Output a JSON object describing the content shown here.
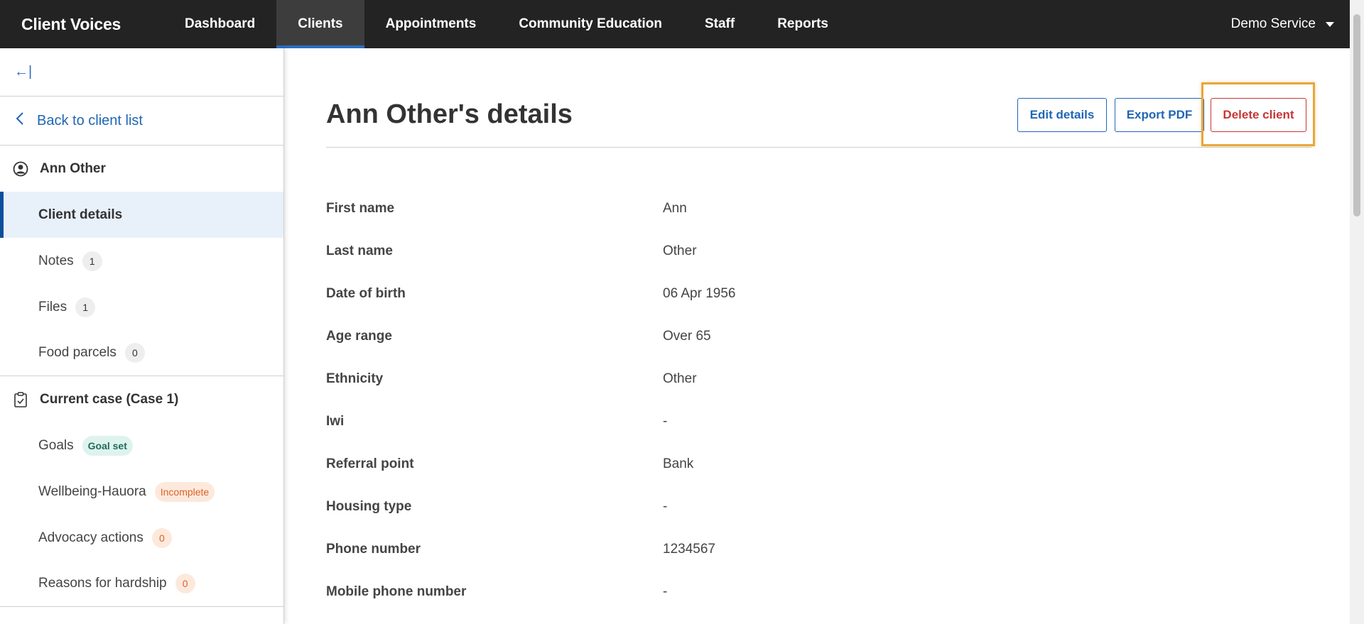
{
  "app": {
    "brand": "Client Voices"
  },
  "nav": {
    "items": [
      {
        "label": "Dashboard"
      },
      {
        "label": "Clients"
      },
      {
        "label": "Appointments"
      },
      {
        "label": "Community Education"
      },
      {
        "label": "Staff"
      },
      {
        "label": "Reports"
      }
    ],
    "service": "Demo Service"
  },
  "sidebar": {
    "collapse_glyph": "←|",
    "back_label": "Back to client list",
    "client_name": "Ann Other",
    "client_items": [
      {
        "label": "Client details"
      },
      {
        "label": "Notes",
        "badge": "1"
      },
      {
        "label": "Files",
        "badge": "1"
      },
      {
        "label": "Food parcels",
        "badge": "0"
      }
    ],
    "case_title": "Current case (Case 1)",
    "case_items": [
      {
        "label": "Goals",
        "badge": "Goal set"
      },
      {
        "label": "Wellbeing-Hauora",
        "badge": "Incomplete"
      },
      {
        "label": "Advocacy actions",
        "badge": "0"
      },
      {
        "label": "Reasons for hardship",
        "badge": "0"
      }
    ]
  },
  "main": {
    "title": "Ann Other's details",
    "buttons": {
      "edit": "Edit details",
      "export": "Export PDF",
      "delete": "Delete client"
    },
    "fields": [
      {
        "label": "First name",
        "value": "Ann"
      },
      {
        "label": "Last name",
        "value": "Other"
      },
      {
        "label": "Date of birth",
        "value": "06 Apr 1956"
      },
      {
        "label": "Age range",
        "value": "Over 65"
      },
      {
        "label": "Ethnicity",
        "value": "Other"
      },
      {
        "label": "Iwi",
        "value": "-"
      },
      {
        "label": "Referral point",
        "value": "Bank"
      },
      {
        "label": "Housing type",
        "value": "-"
      },
      {
        "label": "Phone number",
        "value": "1234567"
      },
      {
        "label": "Mobile phone number",
        "value": "-"
      }
    ]
  },
  "colors": {
    "nav_bg": "#232323",
    "accent": "#1f66b5",
    "danger": "#c73636",
    "highlight": "#e8a73a"
  }
}
